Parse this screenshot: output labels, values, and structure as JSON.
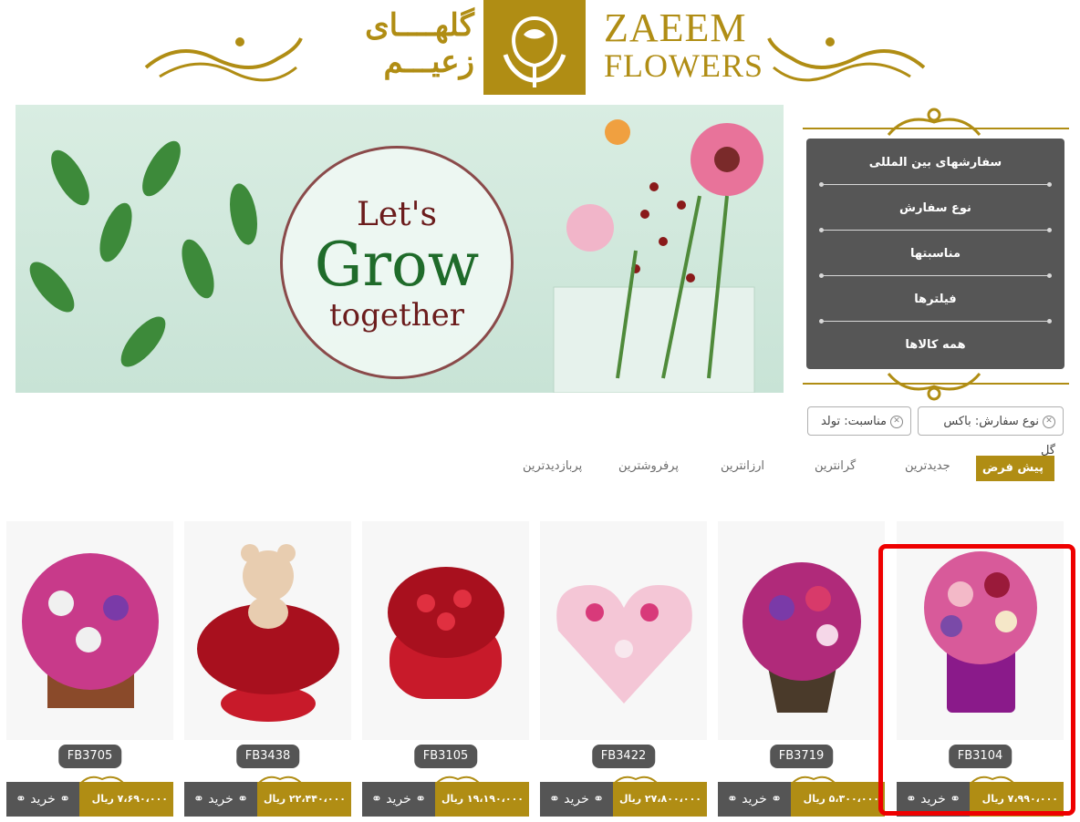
{
  "header": {
    "fa_line1": "گلهــــای",
    "fa_line2": "زعیـــم",
    "brand_line1": "ZAEEM",
    "brand_line2": "FLOWERS"
  },
  "banner": {
    "line1": "Let's",
    "line2": "Grow",
    "line3": "together"
  },
  "menu": {
    "items": [
      {
        "label": "سفارشهای بین المللی"
      },
      {
        "label": "نوع سفارش"
      },
      {
        "label": "مناسبتها"
      },
      {
        "label": "فیلترها"
      },
      {
        "label": "همه کالاها"
      }
    ]
  },
  "filters": {
    "chips": [
      {
        "label": "نوع سفارش: باکس گل"
      },
      {
        "label": "مناسبت: تولد"
      }
    ]
  },
  "sort": {
    "options": [
      {
        "label": "پیش فرض",
        "active": true
      },
      {
        "label": "جدیدترین"
      },
      {
        "label": "گرانترین"
      },
      {
        "label": "ارزانترین"
      },
      {
        "label": "پرفروشترین"
      },
      {
        "label": "پربازدیدترین"
      }
    ]
  },
  "products": [
    {
      "code": "FB3104",
      "price": "۷،۹۹۰،۰۰۰",
      "currency": "ریال",
      "buy": "خرید"
    },
    {
      "code": "FB3719",
      "price": "۵،۳۰۰،۰۰۰",
      "currency": "ریال",
      "buy": "خرید"
    },
    {
      "code": "FB3422",
      "price": "۲۷،۸۰۰،۰۰۰",
      "currency": "ریال",
      "buy": "خرید"
    },
    {
      "code": "FB3105",
      "price": "۱۹،۱۹۰،۰۰۰",
      "currency": "ریال",
      "buy": "خرید"
    },
    {
      "code": "FB3438",
      "price": "۲۲،۴۴۰،۰۰۰",
      "currency": "ریال",
      "buy": "خرید"
    },
    {
      "code": "FB3705",
      "price": "۷،۶۹۰،۰۰۰",
      "currency": "ریال",
      "buy": "خرید"
    }
  ],
  "colors": {
    "gold": "#b08d14",
    "dark": "#565656",
    "highlight": "#ee0000"
  }
}
